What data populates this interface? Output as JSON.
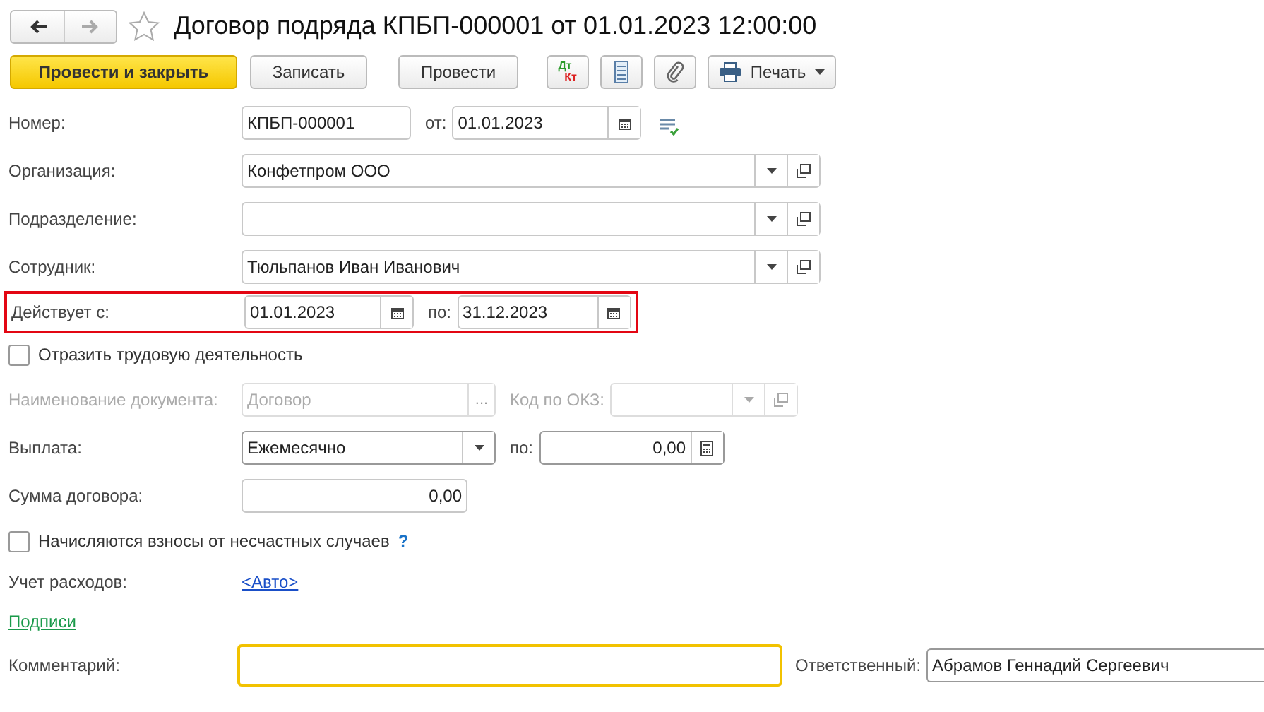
{
  "window": {
    "title": "Договор подряда КПБП-000001 от 01.01.2023 12:00:00",
    "back_enabled": true,
    "forward_enabled": false,
    "favorite": false
  },
  "toolbar": [
    {
      "kind": "primary",
      "label": "Провести и закрыть"
    },
    {
      "kind": "default",
      "label": "Записать"
    },
    {
      "kind": "default",
      "label": "Провести"
    },
    {
      "kind": "dtkt",
      "label": "Дт",
      "label_2": "Кт"
    },
    {
      "kind": "icon-list"
    },
    {
      "kind": "icon-clip"
    },
    {
      "kind": "print",
      "label": "Печать"
    }
  ],
  "form": [
    {
      "kind": "number",
      "label": "Номер:",
      "value": "КПБП-000001",
      "date_label": "от:",
      "date": "01.01.2023"
    },
    {
      "kind": "ref",
      "label": "Организация:",
      "value": "Конфетпром ООО"
    },
    {
      "kind": "ref",
      "label": "Подразделение:"
    },
    {
      "kind": "ref",
      "label": "Сотрудник:",
      "value": "Тюльпанов Иван Иванович"
    },
    {
      "kind": "period",
      "label": "Действует с:",
      "from": "01.01.2023",
      "to_label": "по:",
      "to": "31.12.2023",
      "highlighted": true
    },
    {
      "kind": "checkbox",
      "label": "Отразить трудовую деятельность",
      "checked": false
    },
    {
      "kind": "docname",
      "label": "Наименование документа:",
      "value": "Договор",
      "ellipsis": "...",
      "okz_label": "Код по ОКЗ:",
      "disabled": true
    },
    {
      "kind": "payment",
      "label": "Выплата:",
      "value": "Ежемесячно",
      "amount_label": "по:",
      "amount": "0,00"
    },
    {
      "kind": "sum",
      "label": "Сумма договора:",
      "value": "0,00"
    },
    {
      "kind": "checkbox",
      "label": "Начисляются взносы от несчастных случаев",
      "checked": false,
      "help": "?"
    },
    {
      "kind": "link",
      "label": "Учет расходов:",
      "link": "<Авто>"
    },
    {
      "kind": "section-link",
      "link": "Подписи"
    },
    {
      "kind": "comment",
      "label": "Комментарий:",
      "focused": true,
      "resp_label": "Ответственный:",
      "resp_value": "Абрамов Геннадий Сергеевич"
    }
  ]
}
